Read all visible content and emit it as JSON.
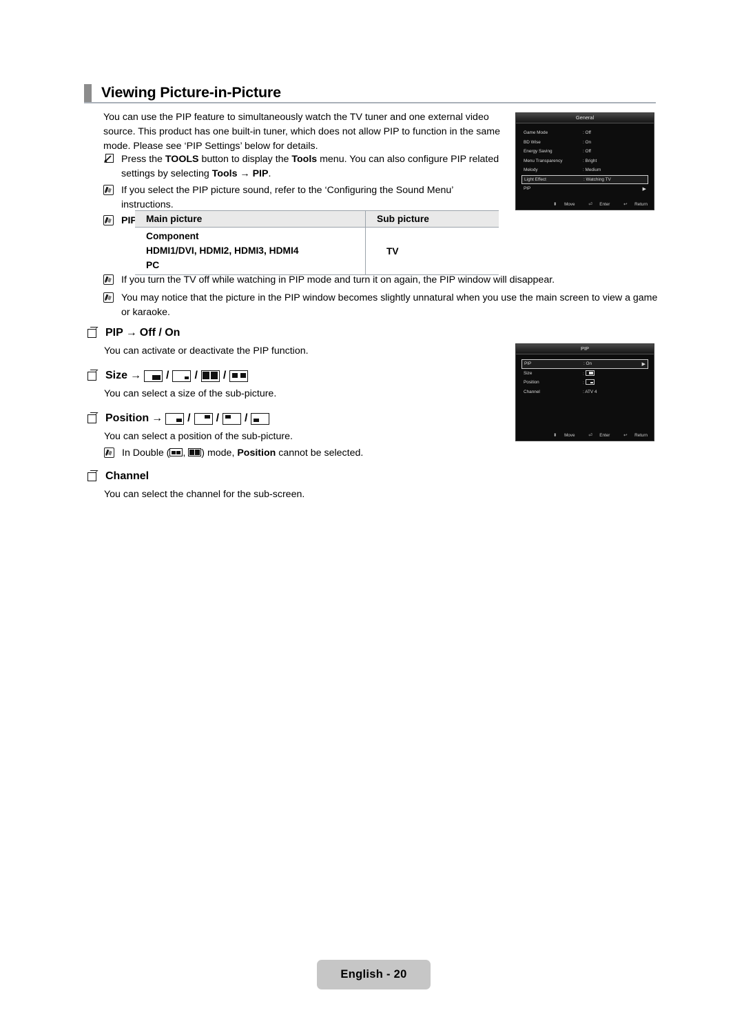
{
  "page": {
    "title": "Viewing Picture-in-Picture",
    "footer_label": "English - 20"
  },
  "intro": {
    "paragraph": "You can use the PIP feature to simultaneously watch the TV tuner and one external video source. This product has one built-in tuner, which does not allow PIP to function in the same mode. Please see ‘PIP Settings’ below for details."
  },
  "notes_top": [
    {
      "icon": "tools-shortcut-icon",
      "text_1": "Press the ",
      "bold_1": "TOOLS",
      "text_2": " button to display the ",
      "bold_2": "Tools",
      "text_3": " menu. You can also configure PIP related settings by selecting ",
      "bold_3": "Tools",
      "text_4": " → ",
      "bold_4": "PIP",
      "text_5": "."
    },
    {
      "icon": "note-pencil-icon",
      "text": "If you select the PIP picture sound, refer to the ‘Configuring the Sound Menu’ instructions."
    },
    {
      "icon": "note-pencil-icon",
      "text": "PIP Settings"
    }
  ],
  "pip_settings_table": {
    "headers": [
      "Main picture",
      "Sub picture"
    ],
    "main_rows": [
      "Component",
      "HDMI1/DVI, HDMI2, HDMI3, HDMI4",
      "PC"
    ],
    "sub_value": "TV"
  },
  "notes_after_table": [
    {
      "icon": "note-pencil-icon",
      "text": "If you turn the TV off while watching in PIP mode and turn it on again, the PIP window will disappear."
    },
    {
      "icon": "note-pencil-icon",
      "text": "You may notice that the picture in the PIP window becomes slightly unnatural when you use the main screen to view a game or karaoke."
    }
  ],
  "sections": [
    {
      "id": "pip",
      "heading": "PIP",
      "arrow": "→",
      "options_text": "Off / On",
      "description": "You can activate or deactivate the PIP function."
    },
    {
      "id": "size",
      "heading": "Size",
      "arrow": "→",
      "icons": [
        "size-large-sub",
        "size-small-sub",
        "size-double-wide",
        "size-double-small"
      ],
      "separator": "/",
      "description": "You can select a size of the sub-picture."
    },
    {
      "id": "position",
      "heading": "Position",
      "arrow": "→",
      "icons": [
        "position-bottom-right",
        "position-top-right",
        "position-top-left",
        "position-bottom-left"
      ],
      "separator": "/",
      "description": "You can select a position of the sub-picture.",
      "note": {
        "icon": "note-pencil-icon",
        "text_1": "In Double (",
        "text_2": ", ",
        "text_3": ") mode, ",
        "bold_1": "Position",
        "text_4": " cannot be selected.",
        "icons": [
          "double-small",
          "double-wide"
        ]
      }
    },
    {
      "id": "channel",
      "heading": "Channel",
      "description": "You can select the channel for the sub-screen."
    }
  ],
  "osd_general": {
    "title": "General",
    "rows": [
      {
        "label": "Game Mode",
        "value": ": Off",
        "selected": false,
        "caret": ""
      },
      {
        "label": "BD Wise",
        "value": ": On",
        "selected": false,
        "caret": ""
      },
      {
        "label": "Energy Saving",
        "value": ": Off",
        "selected": false,
        "caret": ""
      },
      {
        "label": "Menu Transparency",
        "value": ": Bright",
        "selected": false,
        "caret": ""
      },
      {
        "label": "Melody",
        "value": ": Medium",
        "selected": false,
        "caret": ""
      },
      {
        "label": "Light Effect",
        "value": ": Watching TV",
        "selected": true,
        "caret": ""
      },
      {
        "label": "PIP",
        "value": "",
        "selected": false,
        "caret": "▶"
      }
    ],
    "footer": {
      "move": "Move",
      "enter": "Enter",
      "return": "Return",
      "move_icon": "⬍",
      "enter_icon": "⏎",
      "return_icon": "↩"
    }
  },
  "osd_pip": {
    "title": "PIP",
    "rows": [
      {
        "label": "PIP",
        "value": ": On",
        "selected": true,
        "caret": "▶",
        "icon": ""
      },
      {
        "label": "Size",
        "value": ":",
        "selected": false,
        "caret": "",
        "icon": "size-large-sub"
      },
      {
        "label": "Position",
        "value": ":",
        "selected": false,
        "caret": "",
        "icon": "position-bottom-right"
      },
      {
        "label": "Channel",
        "value": ": ATV 4",
        "selected": false,
        "caret": "",
        "icon": ""
      }
    ],
    "footer": {
      "move": "Move",
      "enter": "Enter",
      "return": "Return",
      "move_icon": "⬍",
      "enter_icon": "⏎",
      "return_icon": "↩"
    }
  }
}
